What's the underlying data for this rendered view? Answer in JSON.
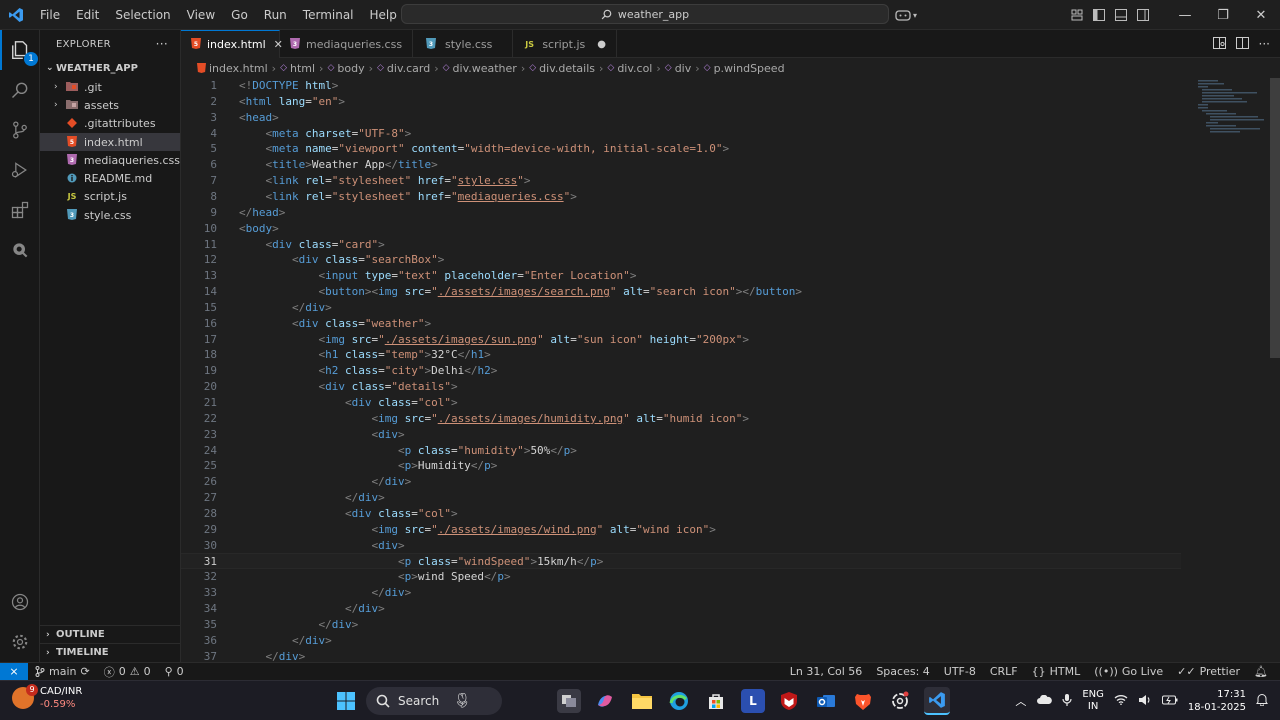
{
  "menu": [
    "File",
    "Edit",
    "Selection",
    "View",
    "Go",
    "Run",
    "Terminal",
    "Help"
  ],
  "search_text": "weather_app",
  "explorer": {
    "title": "EXPLORER",
    "folder": "WEATHER_APP",
    "items": [
      {
        "name": ".git",
        "icon": "git-folder-icon",
        "type": "folder"
      },
      {
        "name": "assets",
        "icon": "folder-icon",
        "type": "folder"
      },
      {
        "name": ".gitattributes",
        "icon": "git-icon",
        "type": "file"
      },
      {
        "name": "index.html",
        "icon": "html-icon",
        "type": "file",
        "selected": true
      },
      {
        "name": "mediaqueries.css",
        "icon": "css-icon",
        "type": "file"
      },
      {
        "name": "README.md",
        "icon": "info-icon",
        "type": "file"
      },
      {
        "name": "script.js",
        "icon": "js-icon",
        "type": "file"
      },
      {
        "name": "style.css",
        "icon": "css-icon",
        "type": "file"
      }
    ],
    "outline": "OUTLINE",
    "timeline": "TIMELINE"
  },
  "tabs": [
    {
      "label": "index.html",
      "icon": "html-icon",
      "active": true
    },
    {
      "label": "mediaqueries.css",
      "icon": "css-icon"
    },
    {
      "label": "style.css",
      "icon": "css-icon"
    },
    {
      "label": "script.js",
      "icon": "js-icon",
      "modified": true
    }
  ],
  "breadcrumb": [
    "index.html",
    "html",
    "body",
    "div.card",
    "div.weather",
    "div.details",
    "div.col",
    "div",
    "p.windSpeed"
  ],
  "current_line": 31,
  "code": [
    [
      [
        "p",
        "<!"
      ],
      [
        "t",
        "DOCTYPE"
      ],
      [
        "x",
        " "
      ],
      [
        "a",
        "html"
      ],
      [
        "p",
        ">"
      ]
    ],
    [
      [
        "p",
        "<"
      ],
      [
        "t",
        "html"
      ],
      [
        "x",
        " "
      ],
      [
        "a",
        "lang"
      ],
      [
        "x",
        "="
      ],
      [
        "s",
        "\"en\""
      ],
      [
        "p",
        ">"
      ]
    ],
    [
      [
        "p",
        "<"
      ],
      [
        "t",
        "head"
      ],
      [
        "p",
        ">"
      ]
    ],
    [
      [
        "x",
        "    "
      ],
      [
        "p",
        "<"
      ],
      [
        "t",
        "meta"
      ],
      [
        "x",
        " "
      ],
      [
        "a",
        "charset"
      ],
      [
        "x",
        "="
      ],
      [
        "s",
        "\"UTF-8\""
      ],
      [
        "p",
        ">"
      ]
    ],
    [
      [
        "x",
        "    "
      ],
      [
        "p",
        "<"
      ],
      [
        "t",
        "meta"
      ],
      [
        "x",
        " "
      ],
      [
        "a",
        "name"
      ],
      [
        "x",
        "="
      ],
      [
        "s",
        "\"viewport\""
      ],
      [
        "x",
        " "
      ],
      [
        "a",
        "content"
      ],
      [
        "x",
        "="
      ],
      [
        "s",
        "\"width=device-width, initial-scale=1.0\""
      ],
      [
        "p",
        ">"
      ]
    ],
    [
      [
        "x",
        "    "
      ],
      [
        "p",
        "<"
      ],
      [
        "t",
        "title"
      ],
      [
        "p",
        ">"
      ],
      [
        "x",
        "Weather App"
      ],
      [
        "p",
        "</"
      ],
      [
        "t",
        "title"
      ],
      [
        "p",
        ">"
      ]
    ],
    [
      [
        "x",
        "    "
      ],
      [
        "p",
        "<"
      ],
      [
        "t",
        "link"
      ],
      [
        "x",
        " "
      ],
      [
        "a",
        "rel"
      ],
      [
        "x",
        "="
      ],
      [
        "s",
        "\"stylesheet\""
      ],
      [
        "x",
        " "
      ],
      [
        "a",
        "href"
      ],
      [
        "x",
        "="
      ],
      [
        "s",
        "\""
      ],
      [
        "su",
        "style.css"
      ],
      [
        "s",
        "\""
      ],
      [
        "p",
        ">"
      ]
    ],
    [
      [
        "x",
        "    "
      ],
      [
        "p",
        "<"
      ],
      [
        "t",
        "link"
      ],
      [
        "x",
        " "
      ],
      [
        "a",
        "rel"
      ],
      [
        "x",
        "="
      ],
      [
        "s",
        "\"stylesheet\""
      ],
      [
        "x",
        " "
      ],
      [
        "a",
        "href"
      ],
      [
        "x",
        "="
      ],
      [
        "s",
        "\""
      ],
      [
        "su",
        "mediaqueries.css"
      ],
      [
        "s",
        "\""
      ],
      [
        "p",
        ">"
      ]
    ],
    [
      [
        "p",
        "</"
      ],
      [
        "t",
        "head"
      ],
      [
        "p",
        ">"
      ]
    ],
    [
      [
        "p",
        "<"
      ],
      [
        "t",
        "body"
      ],
      [
        "p",
        ">"
      ]
    ],
    [
      [
        "x",
        "    "
      ],
      [
        "p",
        "<"
      ],
      [
        "t",
        "div"
      ],
      [
        "x",
        " "
      ],
      [
        "a",
        "class"
      ],
      [
        "x",
        "="
      ],
      [
        "s",
        "\"card\""
      ],
      [
        "p",
        ">"
      ]
    ],
    [
      [
        "x",
        "        "
      ],
      [
        "p",
        "<"
      ],
      [
        "t",
        "div"
      ],
      [
        "x",
        " "
      ],
      [
        "a",
        "class"
      ],
      [
        "x",
        "="
      ],
      [
        "s",
        "\"searchBox\""
      ],
      [
        "p",
        ">"
      ]
    ],
    [
      [
        "x",
        "            "
      ],
      [
        "p",
        "<"
      ],
      [
        "t",
        "input"
      ],
      [
        "x",
        " "
      ],
      [
        "a",
        "type"
      ],
      [
        "x",
        "="
      ],
      [
        "s",
        "\"text\""
      ],
      [
        "x",
        " "
      ],
      [
        "a",
        "placeholder"
      ],
      [
        "x",
        "="
      ],
      [
        "s",
        "\"Enter Location\""
      ],
      [
        "p",
        ">"
      ]
    ],
    [
      [
        "x",
        "            "
      ],
      [
        "p",
        "<"
      ],
      [
        "t",
        "button"
      ],
      [
        "p",
        "><"
      ],
      [
        "t",
        "img"
      ],
      [
        "x",
        " "
      ],
      [
        "a",
        "src"
      ],
      [
        "x",
        "="
      ],
      [
        "s",
        "\""
      ],
      [
        "su",
        "./assets/images/search.png"
      ],
      [
        "s",
        "\""
      ],
      [
        "x",
        " "
      ],
      [
        "a",
        "alt"
      ],
      [
        "x",
        "="
      ],
      [
        "s",
        "\"search icon\""
      ],
      [
        "p",
        "></"
      ],
      [
        "t",
        "button"
      ],
      [
        "p",
        ">"
      ]
    ],
    [
      [
        "x",
        "        "
      ],
      [
        "p",
        "</"
      ],
      [
        "t",
        "div"
      ],
      [
        "p",
        ">"
      ]
    ],
    [
      [
        "x",
        "        "
      ],
      [
        "p",
        "<"
      ],
      [
        "t",
        "div"
      ],
      [
        "x",
        " "
      ],
      [
        "a",
        "class"
      ],
      [
        "x",
        "="
      ],
      [
        "s",
        "\"weather\""
      ],
      [
        "p",
        ">"
      ]
    ],
    [
      [
        "x",
        "            "
      ],
      [
        "p",
        "<"
      ],
      [
        "t",
        "img"
      ],
      [
        "x",
        " "
      ],
      [
        "a",
        "src"
      ],
      [
        "x",
        "="
      ],
      [
        "s",
        "\""
      ],
      [
        "su",
        "./assets/images/sun.png"
      ],
      [
        "s",
        "\""
      ],
      [
        "x",
        " "
      ],
      [
        "a",
        "alt"
      ],
      [
        "x",
        "="
      ],
      [
        "s",
        "\"sun icon\""
      ],
      [
        "x",
        " "
      ],
      [
        "a",
        "height"
      ],
      [
        "x",
        "="
      ],
      [
        "s",
        "\"200px\""
      ],
      [
        "p",
        ">"
      ]
    ],
    [
      [
        "x",
        "            "
      ],
      [
        "p",
        "<"
      ],
      [
        "t",
        "h1"
      ],
      [
        "x",
        " "
      ],
      [
        "a",
        "class"
      ],
      [
        "x",
        "="
      ],
      [
        "s",
        "\"temp\""
      ],
      [
        "p",
        ">"
      ],
      [
        "x",
        "32°C"
      ],
      [
        "p",
        "</"
      ],
      [
        "t",
        "h1"
      ],
      [
        "p",
        ">"
      ]
    ],
    [
      [
        "x",
        "            "
      ],
      [
        "p",
        "<"
      ],
      [
        "t",
        "h2"
      ],
      [
        "x",
        " "
      ],
      [
        "a",
        "class"
      ],
      [
        "x",
        "="
      ],
      [
        "s",
        "\"city\""
      ],
      [
        "p",
        ">"
      ],
      [
        "x",
        "Delhi"
      ],
      [
        "p",
        "</"
      ],
      [
        "t",
        "h2"
      ],
      [
        "p",
        ">"
      ]
    ],
    [
      [
        "x",
        "            "
      ],
      [
        "p",
        "<"
      ],
      [
        "t",
        "div"
      ],
      [
        "x",
        " "
      ],
      [
        "a",
        "class"
      ],
      [
        "x",
        "="
      ],
      [
        "s",
        "\"details\""
      ],
      [
        "p",
        ">"
      ]
    ],
    [
      [
        "x",
        "                "
      ],
      [
        "p",
        "<"
      ],
      [
        "t",
        "div"
      ],
      [
        "x",
        " "
      ],
      [
        "a",
        "class"
      ],
      [
        "x",
        "="
      ],
      [
        "s",
        "\"col\""
      ],
      [
        "p",
        ">"
      ]
    ],
    [
      [
        "x",
        "                    "
      ],
      [
        "p",
        "<"
      ],
      [
        "t",
        "img"
      ],
      [
        "x",
        " "
      ],
      [
        "a",
        "src"
      ],
      [
        "x",
        "="
      ],
      [
        "s",
        "\""
      ],
      [
        "su",
        "./assets/images/humidity.png"
      ],
      [
        "s",
        "\""
      ],
      [
        "x",
        " "
      ],
      [
        "a",
        "alt"
      ],
      [
        "x",
        "="
      ],
      [
        "s",
        "\"humid icon\""
      ],
      [
        "p",
        ">"
      ]
    ],
    [
      [
        "x",
        "                    "
      ],
      [
        "p",
        "<"
      ],
      [
        "t",
        "div"
      ],
      [
        "p",
        ">"
      ]
    ],
    [
      [
        "x",
        "                        "
      ],
      [
        "p",
        "<"
      ],
      [
        "t",
        "p"
      ],
      [
        "x",
        " "
      ],
      [
        "a",
        "class"
      ],
      [
        "x",
        "="
      ],
      [
        "s",
        "\"humidity\""
      ],
      [
        "p",
        ">"
      ],
      [
        "x",
        "50%"
      ],
      [
        "p",
        "</"
      ],
      [
        "t",
        "p"
      ],
      [
        "p",
        ">"
      ]
    ],
    [
      [
        "x",
        "                        "
      ],
      [
        "p",
        "<"
      ],
      [
        "t",
        "p"
      ],
      [
        "p",
        ">"
      ],
      [
        "x",
        "Humidity"
      ],
      [
        "p",
        "</"
      ],
      [
        "t",
        "p"
      ],
      [
        "p",
        ">"
      ]
    ],
    [
      [
        "x",
        "                    "
      ],
      [
        "p",
        "</"
      ],
      [
        "t",
        "div"
      ],
      [
        "p",
        ">"
      ]
    ],
    [
      [
        "x",
        "                "
      ],
      [
        "p",
        "</"
      ],
      [
        "t",
        "div"
      ],
      [
        "p",
        ">"
      ]
    ],
    [
      [
        "x",
        "                "
      ],
      [
        "p",
        "<"
      ],
      [
        "t",
        "div"
      ],
      [
        "x",
        " "
      ],
      [
        "a",
        "class"
      ],
      [
        "x",
        "="
      ],
      [
        "s",
        "\"col\""
      ],
      [
        "p",
        ">"
      ]
    ],
    [
      [
        "x",
        "                    "
      ],
      [
        "p",
        "<"
      ],
      [
        "t",
        "img"
      ],
      [
        "x",
        " "
      ],
      [
        "a",
        "src"
      ],
      [
        "x",
        "="
      ],
      [
        "s",
        "\""
      ],
      [
        "su",
        "./assets/images/wind.png"
      ],
      [
        "s",
        "\""
      ],
      [
        "x",
        " "
      ],
      [
        "a",
        "alt"
      ],
      [
        "x",
        "="
      ],
      [
        "s",
        "\"wind icon\""
      ],
      [
        "p",
        ">"
      ]
    ],
    [
      [
        "x",
        "                    "
      ],
      [
        "p",
        "<"
      ],
      [
        "t",
        "div"
      ],
      [
        "p",
        ">"
      ]
    ],
    [
      [
        "x",
        "                        "
      ],
      [
        "p",
        "<"
      ],
      [
        "t",
        "p"
      ],
      [
        "x",
        " "
      ],
      [
        "a",
        "class"
      ],
      [
        "x",
        "="
      ],
      [
        "s",
        "\"windSpeed\""
      ],
      [
        "p",
        ">"
      ],
      [
        "x",
        "15km/h"
      ],
      [
        "p",
        "</"
      ],
      [
        "t",
        "p"
      ],
      [
        "p",
        ">"
      ]
    ],
    [
      [
        "x",
        "                        "
      ],
      [
        "p",
        "<"
      ],
      [
        "t",
        "p"
      ],
      [
        "p",
        ">"
      ],
      [
        "x",
        "wind Speed"
      ],
      [
        "p",
        "</"
      ],
      [
        "t",
        "p"
      ],
      [
        "p",
        ">"
      ]
    ],
    [
      [
        "x",
        "                    "
      ],
      [
        "p",
        "</"
      ],
      [
        "t",
        "div"
      ],
      [
        "p",
        ">"
      ]
    ],
    [
      [
        "x",
        "                "
      ],
      [
        "p",
        "</"
      ],
      [
        "t",
        "div"
      ],
      [
        "p",
        ">"
      ]
    ],
    [
      [
        "x",
        "            "
      ],
      [
        "p",
        "</"
      ],
      [
        "t",
        "div"
      ],
      [
        "p",
        ">"
      ]
    ],
    [
      [
        "x",
        "        "
      ],
      [
        "p",
        "</"
      ],
      [
        "t",
        "div"
      ],
      [
        "p",
        ">"
      ]
    ],
    [
      [
        "x",
        "    "
      ],
      [
        "p",
        "</"
      ],
      [
        "t",
        "div"
      ],
      [
        "p",
        ">"
      ]
    ]
  ],
  "status": {
    "branch": "main",
    "errors": "0",
    "warnings": "0",
    "ports": "0",
    "cursor": "Ln 31, Col 56",
    "spaces": "Spaces: 4",
    "encoding": "UTF-8",
    "eol": "CRLF",
    "language": "HTML",
    "golive": "Go Live",
    "prettier": "Prettier"
  },
  "taskbar": {
    "weather_badge": "9",
    "ticker": "CAD/INR",
    "ticker_change": "-0.59%",
    "search": "Search",
    "lang_top": "ENG",
    "lang_bottom": "IN",
    "time": "17:31",
    "date": "18-01-2025"
  },
  "colors": {
    "accent": "#0078d4",
    "html_icon": "#e44d26",
    "css_icon": "#519aba",
    "js_icon": "#cbcb41"
  }
}
